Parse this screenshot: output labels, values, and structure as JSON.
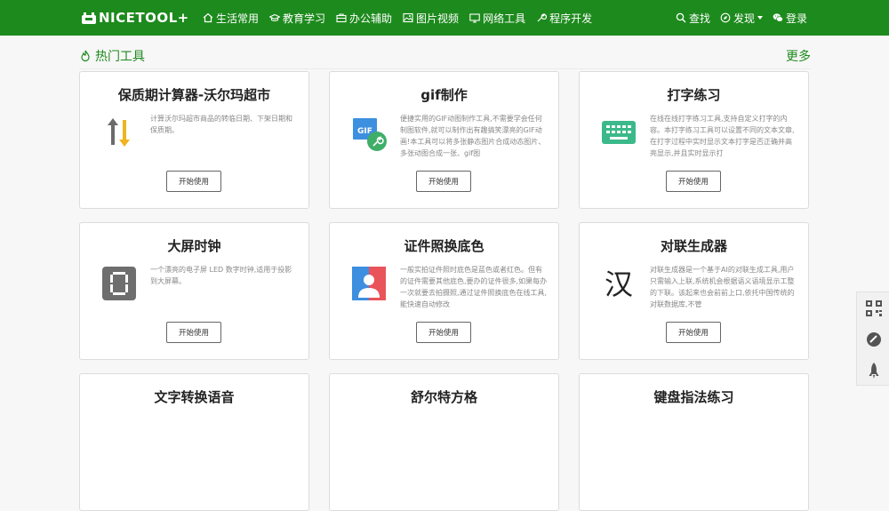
{
  "nav": {
    "logo": "NICETOOL+",
    "links": [
      "生活常用",
      "教育学习",
      "办公辅助",
      "图片视频",
      "网络工具",
      "程序开发"
    ],
    "search": "查找",
    "discover": "发现",
    "login": "登录"
  },
  "section": {
    "title": "热门工具",
    "more": "更多"
  },
  "cards": [
    {
      "title": "保质期计算器-沃尔玛超市",
      "desc": "计算沃尔玛超市商品的转临日期、下架日期和保质期。",
      "button": "开始使用",
      "icon": "arrows-updown-icon"
    },
    {
      "title": "gif制作",
      "desc": "便捷实用的GIF动图制作工具,不需要学会任何制图软件,就可以制作出有趣搞笑漂亮的GIF动画!本工具可以将多张静态图片合成动态图片、多张动图合成一张、gif图",
      "button": "开始使用",
      "icon": "gif-wrench-icon"
    },
    {
      "title": "打字练习",
      "desc": "在线在线打字练习工具,支持自定义打字的内容。本打字练习工具可以设置不同的文本文章,在打字过程中实时显示文本打字是否正确并高亮显示,并且实时显示打",
      "button": "开始使用",
      "icon": "keyboard-icon"
    },
    {
      "title": "大屏时钟",
      "desc": "一个漂亮的电子屏 LED 数字时钟,适用于投影到大屏幕。",
      "button": "开始使用",
      "icon": "led-digit-icon"
    },
    {
      "title": "证件照换底色",
      "desc": "一般实拍证件照时底色是蓝色或者红色。但有的证件需要其他底色,要办的证件很多,如果每办一次就要去拍摄照,通过证件照换底色在线工具,能快速自动修改",
      "button": "开始使用",
      "icon": "id-photo-icon"
    },
    {
      "title": "对联生成器",
      "desc": "对联生成器是一个基于AI的对联生成工具,用户只需输入上联,系统机会根据语义语境显示工整的下联。该起来也会前前上口,依托中国传统的对联数据库,不管",
      "button": "开始使用",
      "icon": "han-character-icon"
    },
    {
      "title": "文字转换语音",
      "desc": "",
      "button": "",
      "icon": ""
    },
    {
      "title": "舒尔特方格",
      "desc": "",
      "button": "",
      "icon": ""
    },
    {
      "title": "键盘指法练习",
      "desc": "",
      "button": "",
      "icon": ""
    }
  ],
  "float_bar": [
    "qrcode-icon",
    "feedback-icon",
    "rocket-top-icon"
  ],
  "colors": {
    "brand": "#1d8a1d",
    "card_border": "#dcdcdc",
    "page_bg": "#f7f7f7"
  }
}
